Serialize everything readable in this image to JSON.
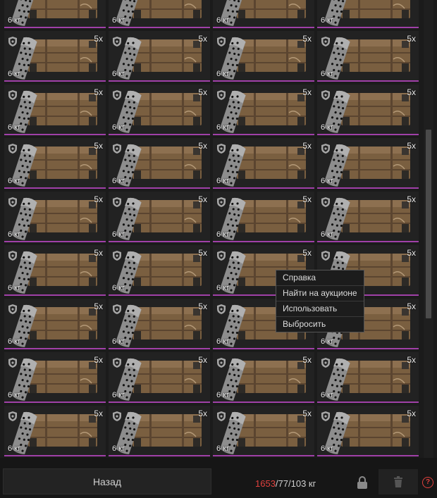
{
  "inventory": {
    "item_weight": "6 кг",
    "item_quantity": "5x",
    "columns": 4,
    "rows": 9
  },
  "context_menu": {
    "items": [
      "Справка",
      "Найти на аукционе",
      "Использовать",
      "Выбросить"
    ]
  },
  "footer": {
    "back_label": "Назад",
    "weight_current": "1653",
    "weight_rest": "/77/103 кг",
    "help_label": "?"
  },
  "colors": {
    "rarity_border": "#a040a8",
    "weight_over": "#e0413e"
  },
  "icons": [
    "shield-icon",
    "lock-icon",
    "trash-icon",
    "help-icon"
  ]
}
